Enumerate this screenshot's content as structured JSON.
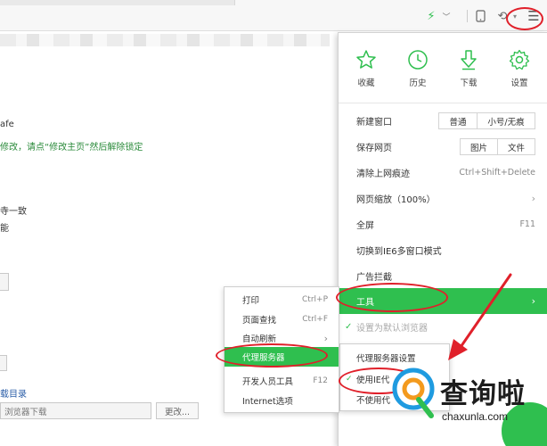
{
  "toolbar": {
    "bolt_icon": "lightning-icon",
    "undo_glyph": "⟲",
    "menu_glyph": "☰"
  },
  "page": {
    "line_safe": "afe",
    "line_lock": "修改，请点“修改主页”然后解除锁定",
    "line_consistent": "寺一致",
    "line_function": "能",
    "line_dir": "载目录",
    "download_input": "浏览器下载",
    "change_button": "更改..."
  },
  "quick_actions": [
    {
      "label": "收藏",
      "icon": "star-icon"
    },
    {
      "label": "历史",
      "icon": "clock-icon"
    },
    {
      "label": "下载",
      "icon": "download-icon"
    },
    {
      "label": "设置",
      "icon": "gear-icon"
    }
  ],
  "menu": {
    "new_window": {
      "label": "新建窗口",
      "opt1": "普通",
      "opt2": "小号/无痕"
    },
    "save_page": {
      "label": "保存网页",
      "opt1": "图片",
      "opt2": "文件"
    },
    "clear_traces": {
      "label": "清除上网痕迹",
      "shortcut": "Ctrl+Shift+Delete"
    },
    "zoom": {
      "label": "网页缩放（100%）"
    },
    "fullscreen": {
      "label": "全屏",
      "shortcut": "F11"
    },
    "ie6_mode": {
      "label": "切换到IE6多窗口模式"
    },
    "adblock": {
      "label": "广告拦截"
    },
    "tools": {
      "label": "工具"
    },
    "set_default": {
      "label": "设置为默认浏览器"
    },
    "arrow": "›"
  },
  "tools_menu": {
    "print": {
      "label": "打印",
      "shortcut": "Ctrl+P"
    },
    "find": {
      "label": "页面查找",
      "shortcut": "Ctrl+F"
    },
    "auto_refresh": {
      "label": "自动刷新"
    },
    "proxy": {
      "label": "代理服务器"
    },
    "devtools": {
      "label": "开发人员工具",
      "shortcut": "F12"
    },
    "internet_options": {
      "label": "Internet选项"
    }
  },
  "proxy_menu": {
    "settings": {
      "label": "代理服务器设置"
    },
    "use_ie": {
      "label": "使用IE代"
    },
    "dont_use": {
      "label": "不使用代"
    }
  },
  "watermark": {
    "text": "查询啦",
    "url": "chaxunla.com"
  },
  "colors": {
    "accent": "#2fbf4f",
    "annotation": "#e0202a"
  }
}
